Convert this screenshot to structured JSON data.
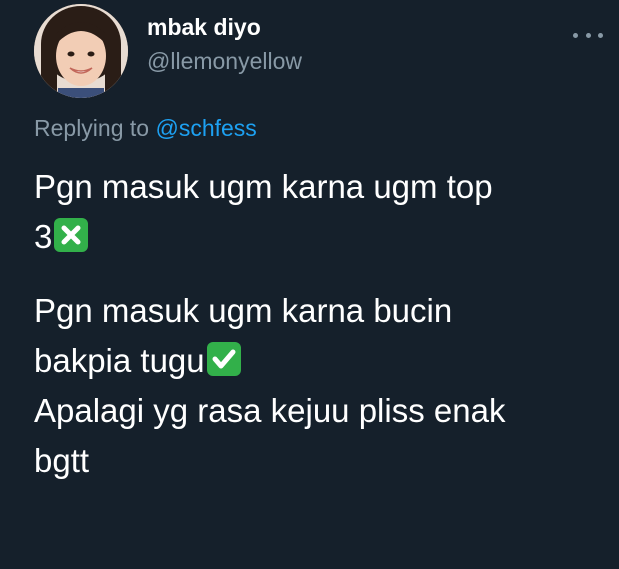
{
  "user": {
    "display_name": "mbak diyo",
    "handle": "@llemonyellow"
  },
  "reply": {
    "prefix": "Replying to",
    "mention": "@schfess"
  },
  "body": {
    "para1_line1": "Pgn masuk ugm karna ugm top",
    "para1_line2": "3",
    "para2_line1": "Pgn masuk ugm karna bucin",
    "para2_line2": "bakpia tugu",
    "para2_line3": "Apalagi yg rasa kejuu pliss enak",
    "para2_line4": "bgtt"
  },
  "icons": {
    "more": "more-horizontal-icon",
    "cross_emoji": "cross-mark-emoji-icon",
    "check_emoji": "check-mark-emoji-icon"
  },
  "colors": {
    "background": "#15202b",
    "primary_text": "#ffffff",
    "secondary_text": "#8899a6",
    "link": "#1da1f2",
    "emoji_green": "#32b04a"
  }
}
